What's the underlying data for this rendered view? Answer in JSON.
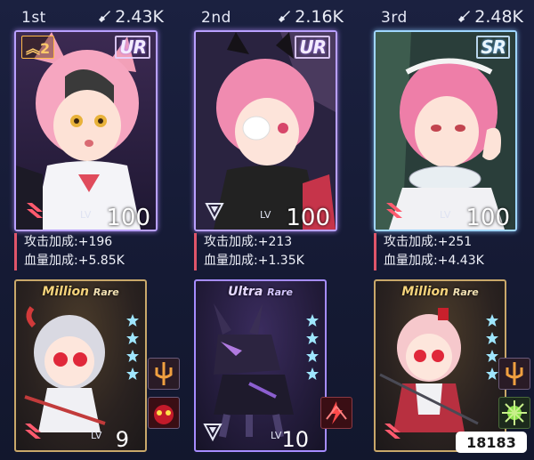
{
  "cards": [
    {
      "rank": "1st",
      "power": "2.43K",
      "rarity": "UR",
      "promo": "2",
      "lv_label": "LV",
      "level": "100",
      "atk_label": "攻击加成",
      "atk": "+196",
      "hp_label": "血量加成",
      "hp": "+5.85K",
      "mech_rarity_a": "Million",
      "mech_rarity_b": "Rare",
      "mech_lv_label": "LV",
      "mech_level": "9",
      "stars": 4
    },
    {
      "rank": "2nd",
      "power": "2.16K",
      "rarity": "UR",
      "promo": "",
      "lv_label": "LV",
      "level": "100",
      "atk_label": "攻击加成",
      "atk": "+213",
      "hp_label": "血量加成",
      "hp": "+1.35K",
      "mech_rarity_a": "Ultra",
      "mech_rarity_b": "Rare",
      "mech_lv_label": "LV",
      "mech_level": "10",
      "stars": 4
    },
    {
      "rank": "3rd",
      "power": "2.48K",
      "rarity": "SR",
      "promo": "",
      "lv_label": "LV",
      "level": "100",
      "atk_label": "攻击加成",
      "atk": "+251",
      "hp_label": "血量加成",
      "hp": "+4.43K",
      "mech_rarity_a": "Million",
      "mech_rarity_b": "Rare",
      "mech_lv_label": "LV",
      "mech_level": "",
      "stars": 4
    }
  ],
  "watermark": "18183",
  "colors": {
    "ur_border": "#b9a0ff",
    "sr_border": "#9fd6ff",
    "million_border": "#c9a86a",
    "ultra_border": "#a68cff",
    "star": "#9fe6ff",
    "stat_bar": "#e0556a"
  }
}
